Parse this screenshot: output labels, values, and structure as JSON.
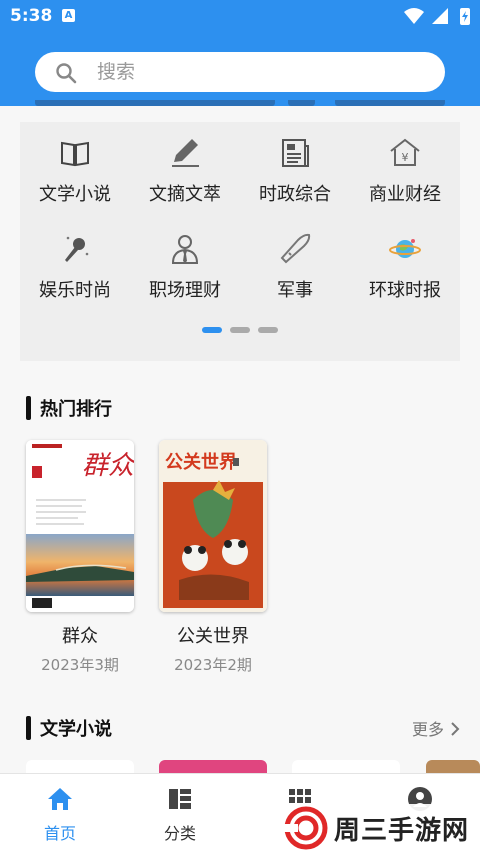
{
  "status_bar": {
    "time": "5:38",
    "notification_badge": "A"
  },
  "search": {
    "placeholder": "搜索",
    "value": ""
  },
  "categories": [
    {
      "label": "文学小说",
      "icon": "book-icon"
    },
    {
      "label": "文摘文萃",
      "icon": "pen-icon"
    },
    {
      "label": "时政综合",
      "icon": "newspaper-icon"
    },
    {
      "label": "商业财经",
      "icon": "yen-house-icon"
    },
    {
      "label": "娱乐时尚",
      "icon": "microphone-icon"
    },
    {
      "label": "职场理财",
      "icon": "person-tie-icon"
    },
    {
      "label": "军事",
      "icon": "bullet-icon"
    },
    {
      "label": "环球时报",
      "icon": "planet-icon"
    }
  ],
  "pager": {
    "pages": 3,
    "current": 1
  },
  "hot_section": {
    "title": "热门排行",
    "books": [
      {
        "title": "群众",
        "issue": "2023年3期",
        "cover_text": "群众"
      },
      {
        "title": "公关世界",
        "issue": "2023年2期",
        "cover_text": "公关世界"
      }
    ]
  },
  "literature_section": {
    "title": "文学小说",
    "more_label": "更多"
  },
  "tabs": [
    {
      "label": "首页",
      "icon": "home-icon",
      "active": true
    },
    {
      "label": "分类",
      "icon": "category-icon",
      "active": false
    },
    {
      "label": "",
      "icon": "grid-icon",
      "active": false
    },
    {
      "label": "",
      "icon": "profile-icon",
      "active": false
    }
  ],
  "watermark": {
    "text": "周三手游网"
  },
  "colors": {
    "primary": "#2d90ef",
    "panel": "#eeeeee",
    "text": "#222222",
    "muted": "#888888"
  }
}
